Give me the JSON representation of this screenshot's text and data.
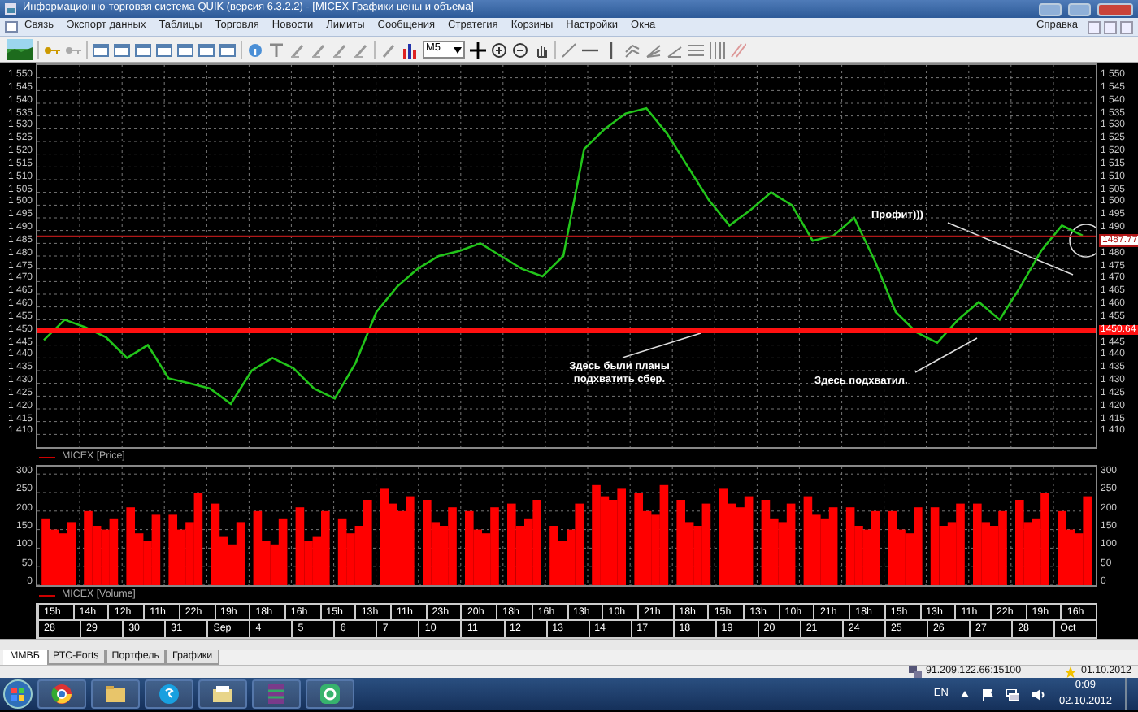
{
  "window": {
    "title": "Информационно-торговая система QUIK (версия 6.3.2.2) - [MICEX Графики цены и объема]"
  },
  "menu": [
    "Связь",
    "Экспорт данных",
    "Таблицы",
    "Торговля",
    "Новости",
    "Лимиты",
    "Сообщения",
    "Стратегия",
    "Корзины",
    "Настройки",
    "Окна"
  ],
  "menu_right": "Справка",
  "toolbar": {
    "timeframe": "M5"
  },
  "price_panel": {
    "right_ticks": [
      "1 550",
      "1 545",
      "1 540",
      "1 535",
      "1 530",
      "1 525",
      "1 520",
      "1 515",
      "1 510",
      "1 505",
      "1 500",
      "1 495",
      "1 490",
      "1 480",
      "1 475",
      "1 470",
      "1 465",
      "1 460",
      "1 455",
      "1 445",
      "1 440",
      "1 435",
      "1 430",
      "1 425",
      "1 420",
      "1 415",
      "1 410"
    ],
    "chart_data": {
      "type": "line",
      "ylim": [
        1405,
        1555
      ],
      "grid": true,
      "yticks": [
        {
          "value": 1550,
          "label": "1 550"
        },
        {
          "value": 1545,
          "label": "1 545"
        },
        {
          "value": 1540,
          "label": "1 540"
        },
        {
          "value": 1535,
          "label": "1 535"
        },
        {
          "value": 1530,
          "label": "1 530"
        },
        {
          "value": 1525,
          "label": "1 525"
        },
        {
          "value": 1520,
          "label": "1 520"
        },
        {
          "value": 1515,
          "label": "1 515"
        },
        {
          "value": 1510,
          "label": "1 510"
        },
        {
          "value": 1505,
          "label": "1 505"
        },
        {
          "value": 1500,
          "label": "1 500"
        },
        {
          "value": 1495,
          "label": "1 495"
        },
        {
          "value": 1490,
          "label": "1 490"
        },
        {
          "value": 1485,
          "label": "1 485"
        },
        {
          "value": 1480,
          "label": "1 480"
        },
        {
          "value": 1475,
          "label": "1 475"
        },
        {
          "value": 1470,
          "label": "1 470"
        },
        {
          "value": 1465,
          "label": "1 465"
        },
        {
          "value": 1460,
          "label": "1 460"
        },
        {
          "value": 1455,
          "label": "1 455"
        },
        {
          "value": 1450,
          "label": "1 450"
        },
        {
          "value": 1445,
          "label": "1 445"
        },
        {
          "value": 1440,
          "label": "1 440"
        },
        {
          "value": 1435,
          "label": "1 435"
        },
        {
          "value": 1430,
          "label": "1 430"
        },
        {
          "value": 1425,
          "label": "1 425"
        },
        {
          "value": 1420,
          "label": "1 420"
        },
        {
          "value": 1415,
          "label": "1 415"
        },
        {
          "value": 1410,
          "label": "1 410"
        }
      ],
      "series": [
        {
          "name": "MICEX [Price]",
          "color": "#22c41a",
          "values": [
            1447,
            1455,
            1452,
            1448,
            1440,
            1445,
            1432,
            1430,
            1428,
            1422,
            1435,
            1440,
            1436,
            1428,
            1424,
            1438,
            1458,
            1468,
            1475,
            1480,
            1482,
            1485,
            1480,
            1475,
            1472,
            1480,
            1522,
            1530,
            1536,
            1538,
            1528,
            1515,
            1502,
            1492,
            1498,
            1505,
            1500,
            1486,
            1488,
            1495,
            1478,
            1458,
            1450,
            1446,
            1455,
            1462,
            1455,
            1468,
            1482,
            1492,
            1488
          ]
        }
      ],
      "ref_lines": [
        {
          "axis": "y",
          "value": 1487.77,
          "label": "1487.77",
          "color": "#b01818"
        },
        {
          "axis": "y",
          "value": 1450.64,
          "label": "1450.64",
          "color": "#ff1010"
        }
      ],
      "annotations": [
        {
          "text": "Профит)))"
        },
        {
          "text": "Здесь были планы подхватить сбер."
        },
        {
          "text": "Здесь подхватил."
        }
      ]
    }
  },
  "volume_panel": {
    "right_ticks": [
      "300",
      "250",
      "200",
      "150",
      "100",
      "50",
      "0"
    ],
    "chart_data": {
      "type": "bar",
      "ylim": [
        0,
        320
      ],
      "grid": true,
      "yticks": [
        300,
        250,
        200,
        150,
        100,
        50,
        0
      ],
      "series": [
        {
          "name": "MICEX [Volume]",
          "color": "#ff0000",
          "values": [
            180,
            150,
            140,
            170,
            200,
            160,
            150,
            180,
            210,
            140,
            120,
            190,
            190,
            150,
            170,
            250,
            220,
            130,
            110,
            170,
            200,
            120,
            110,
            180,
            210,
            120,
            130,
            200,
            180,
            140,
            160,
            230,
            260,
            220,
            200,
            240,
            230,
            170,
            160,
            210,
            200,
            150,
            140,
            210,
            220,
            160,
            180,
            230,
            160,
            120,
            150,
            220,
            270,
            240,
            230,
            260,
            250,
            200,
            190,
            270,
            230,
            170,
            160,
            220,
            260,
            220,
            210,
            240,
            230,
            180,
            170,
            220,
            240,
            190,
            180,
            210,
            210,
            160,
            150,
            200,
            200,
            150,
            140,
            210,
            210,
            160,
            170,
            220,
            220,
            170,
            160,
            200,
            230,
            170,
            180,
            250,
            200,
            150,
            140,
            240
          ]
        }
      ]
    }
  },
  "time_axis": {
    "hours": [
      "15h",
      "14h",
      "12h",
      "11h",
      "22h",
      "19h",
      "18h",
      "16h",
      "15h",
      "13h",
      "11h",
      "23h",
      "20h",
      "18h",
      "16h",
      "13h",
      "10h",
      "21h",
      "18h",
      "15h",
      "13h",
      "10h",
      "21h",
      "18h",
      "15h",
      "13h",
      "11h",
      "22h",
      "19h",
      "16h"
    ],
    "dates": [
      "28",
      "29",
      "30",
      "31",
      "Sep",
      "4",
      "5",
      "6",
      "7",
      "10",
      "11",
      "12",
      "13",
      "14",
      "17",
      "18",
      "19",
      "20",
      "21",
      "24",
      "25",
      "26",
      "27",
      "28",
      "Oct"
    ]
  },
  "tabs": [
    {
      "label": "ММВБ",
      "selected": true
    },
    {
      "label": "РТС-Forts",
      "selected": false
    },
    {
      "label": "Портфель",
      "selected": false
    },
    {
      "label": "Графики",
      "selected": false
    }
  ],
  "status_bar": {
    "connection": "91.209.122.66:15100",
    "date": "01.10.2012"
  },
  "taskbar": {
    "language": "EN",
    "time": "0:09",
    "date": "02.10.2012"
  }
}
